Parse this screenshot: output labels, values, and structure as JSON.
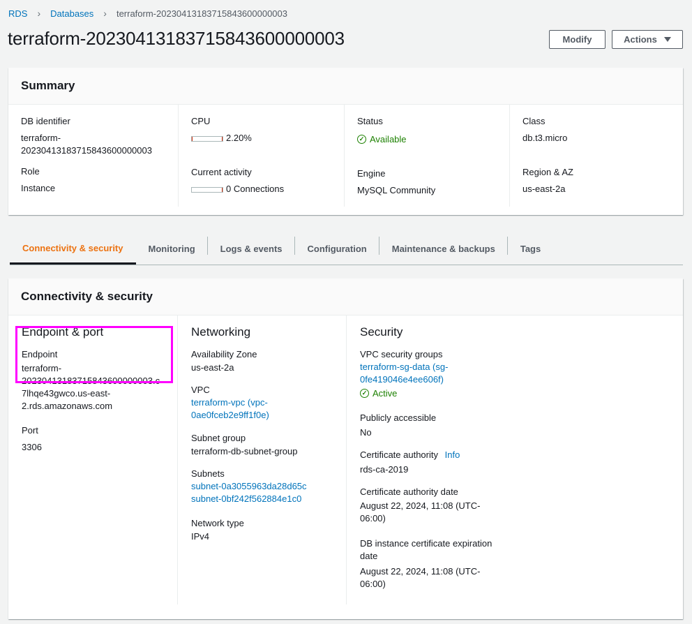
{
  "breadcrumb": {
    "items": [
      "RDS",
      "Databases"
    ],
    "current": "terraform-20230413183715843600000003"
  },
  "page_title": "terraform-20230413183715843600000003",
  "buttons": {
    "modify": "Modify",
    "actions": "Actions"
  },
  "summary": {
    "title": "Summary",
    "db_identifier_label": "DB identifier",
    "db_identifier_line1": "terraform-",
    "db_identifier_line2": "20230413183715843600000003",
    "role_label": "Role",
    "role_value": "Instance",
    "cpu_label": "CPU",
    "cpu_value": "2.20%",
    "cpu_fraction": 0.022,
    "activity_label": "Current activity",
    "activity_value": "0 Connections",
    "status_label": "Status",
    "status_value": "Available",
    "engine_label": "Engine",
    "engine_value": "MySQL Community",
    "class_label": "Class",
    "class_value": "db.t3.micro",
    "region_label": "Region & AZ",
    "region_value": "us-east-2a"
  },
  "tabs": [
    "Connectivity & security",
    "Monitoring",
    "Logs & events",
    "Configuration",
    "Maintenance & backups",
    "Tags"
  ],
  "connectivity": {
    "title": "Connectivity & security",
    "endpoint_port": {
      "heading": "Endpoint & port",
      "endpoint_label": "Endpoint",
      "endpoint_lines": [
        "terraform-",
        "20230413183715843600000003.c",
        "7lhqe43gwco.us-east-",
        "2.rds.amazonaws.com"
      ],
      "port_label": "Port",
      "port_value": "3306"
    },
    "networking": {
      "heading": "Networking",
      "az_label": "Availability Zone",
      "az_value": "us-east-2a",
      "vpc_label": "VPC",
      "vpc_line1": "terraform-vpc (vpc-",
      "vpc_line2": "0ae0fceb2e9ff1f0e)",
      "subnet_group_label": "Subnet group",
      "subnet_group_value": "terraform-db-subnet-group",
      "subnets_label": "Subnets",
      "subnet1": "subnet-0a3055963da28d65c",
      "subnet2": "subnet-0bf242f562884e1c0",
      "network_type_label": "Network type",
      "network_type_value": "IPv4"
    },
    "security": {
      "heading": "Security",
      "vpc_sg_label": "VPC security groups",
      "sg_line1": "terraform-sg-data (sg-",
      "sg_line2": "0fe419046e4ee606f)",
      "sg_status": "Active",
      "public_label": "Publicly accessible",
      "public_value": "No",
      "ca_label": "Certificate authority",
      "ca_info": "Info",
      "ca_value": "rds-ca-2019",
      "ca_date_label": "Certificate authority date",
      "ca_date_line1": "August 22, 2024, 11:08 (UTC-",
      "ca_date_line2": "06:00)",
      "cert_exp_label_line1": "DB instance certificate expiration",
      "cert_exp_label_line2": "date",
      "cert_exp_line1": "August 22, 2024, 11:08 (UTC-",
      "cert_exp_line2": "06:00)"
    }
  },
  "colors": {
    "link": "#0073bb",
    "active_tab": "#ec7211",
    "status_green": "#1d8102",
    "highlight": "#ff00ff"
  }
}
